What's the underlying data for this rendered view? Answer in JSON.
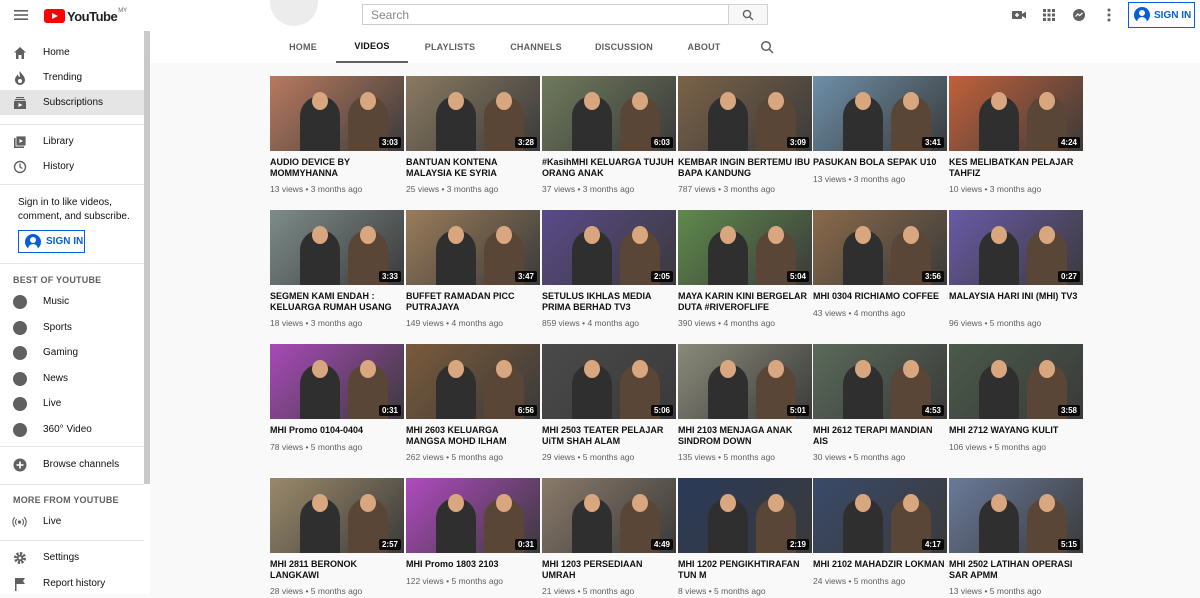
{
  "masthead": {
    "logo_text": "YouTube",
    "country": "MY",
    "search_placeholder": "Search",
    "sign_in": "SIGN IN",
    "icons": [
      "menu-icon",
      "video-camera-icon",
      "apps-icon",
      "chat-icon",
      "more-vert-icon"
    ]
  },
  "sidebar": {
    "main": [
      {
        "label": "Home",
        "icon": "home-icon"
      },
      {
        "label": "Trending",
        "icon": "fire-icon"
      },
      {
        "label": "Subscriptions",
        "icon": "subscriptions-icon",
        "active": true
      }
    ],
    "lib": [
      {
        "label": "Library",
        "icon": "library-icon"
      },
      {
        "label": "History",
        "icon": "history-icon"
      }
    ],
    "signin_prompt": "Sign in to like videos, comment, and subscribe.",
    "sign_in": "SIGN IN",
    "best_heading": "BEST OF YOUTUBE",
    "best": [
      {
        "label": "Music"
      },
      {
        "label": "Sports"
      },
      {
        "label": "Gaming"
      },
      {
        "label": "News"
      },
      {
        "label": "Live"
      },
      {
        "label": "360° Video"
      }
    ],
    "browse": "Browse channels",
    "more_heading": "MORE FROM YOUTUBE",
    "more_live": "Live",
    "settings": "Settings",
    "report_history": "Report history"
  },
  "tabs": [
    "HOME",
    "VIDEOS",
    "PLAYLISTS",
    "CHANNELS",
    "DISCUSSION",
    "ABOUT"
  ],
  "active_tab": "VIDEOS",
  "videos": [
    {
      "title": "AUDIO DEVICE BY MOMMYHANNA",
      "duration": "3:03",
      "views": "13 views",
      "age": "3 months ago",
      "c": "#b97a5f"
    },
    {
      "title": "BANTUAN KONTENA MALAYSIA KE SYRIA",
      "duration": "3:28",
      "views": "25 views",
      "age": "3 months ago",
      "c": "#8a7a62"
    },
    {
      "title": "#KasihMHI KELUARGA TUJUH ORANG ANAK",
      "duration": "6:03",
      "views": "37 views",
      "age": "3 months ago",
      "c": "#6f7a5c"
    },
    {
      "title": "KEMBAR INGIN BERTEMU IBU BAPA KANDUNG",
      "duration": "3:09",
      "views": "787 views",
      "age": "3 months ago",
      "c": "#7a6248"
    },
    {
      "title": "PASUKAN BOLA SEPAK U10",
      "duration": "3:41",
      "views": "13 views",
      "age": "3 months ago",
      "c": "#6e8fa8"
    },
    {
      "title": "KES MELIBATKAN PELAJAR TAHFIZ",
      "duration": "4:24",
      "views": "10 views",
      "age": "3 months ago",
      "c": "#c2603a"
    },
    {
      "title": "SEGMEN KAMI ENDAH : KELUARGA RUMAH USANG",
      "duration": "3:33",
      "views": "18 views",
      "age": "3 months ago",
      "c": "#7d8c8a"
    },
    {
      "title": "BUFFET RAMADAN PICC PUTRAJAYA",
      "duration": "3:47",
      "views": "149 views",
      "age": "4 months ago",
      "c": "#9a7c5a"
    },
    {
      "title": "SETULUS IKHLAS MEDIA PRIMA BERHAD TV3",
      "duration": "2:05",
      "views": "859 views",
      "age": "4 months ago",
      "c": "#5a4a8a"
    },
    {
      "title": "MAYA KARIN KINI BERGELAR DUTA #RIVEROFLIFE",
      "duration": "5:04",
      "views": "390 views",
      "age": "4 months ago",
      "c": "#5f8a4c"
    },
    {
      "title": "MHI 0304 RICHIAMO COFFEE",
      "duration": "3:56",
      "views": "43 views",
      "age": "4 months ago",
      "c": "#8a6a4a"
    },
    {
      "title": "MALAYSIA HARI INI (MHI) TV3",
      "duration": "0:27",
      "views": "96 views",
      "age": "5 months ago",
      "c": "#6a5aa8"
    },
    {
      "title": "MHI Promo 0104-0404",
      "duration": "0:31",
      "views": "78 views",
      "age": "5 months ago",
      "c": "#a84ab8"
    },
    {
      "title": "MHI 2603 KELUARGA MANGSA MOHD ILHAM",
      "duration": "6:56",
      "views": "262 views",
      "age": "5 months ago",
      "c": "#7a5a3a"
    },
    {
      "title": "MHI 2503 TEATER PELAJAR UiTM SHAH ALAM",
      "duration": "5:06",
      "views": "29 views",
      "age": "5 months ago",
      "c": "#4a4a4a"
    },
    {
      "title": "MHI 2103 MENJAGA ANAK SINDROM DOWN",
      "duration": "5:01",
      "views": "135 views",
      "age": "5 months ago",
      "c": "#8a8a7a"
    },
    {
      "title": "MHI 2612 TERAPI MANDIAN AIS",
      "duration": "4:53",
      "views": "30 views",
      "age": "5 months ago",
      "c": "#5a6a5a"
    },
    {
      "title": "MHI 2712 WAYANG KULIT",
      "duration": "3:58",
      "views": "106 views",
      "age": "5 months ago",
      "c": "#4a5a4a"
    },
    {
      "title": "MHI 2811 BERONOK LANGKAWI",
      "duration": "2:57",
      "views": "28 views",
      "age": "5 months ago",
      "c": "#9a8a6a"
    },
    {
      "title": "MHI Promo 1803 2103",
      "duration": "0:31",
      "views": "122 views",
      "age": "5 months ago",
      "c": "#b04ac0"
    },
    {
      "title": "MHI 1203 PERSEDIAAN UMRAH",
      "duration": "4:49",
      "views": "21 views",
      "age": "5 months ago",
      "c": "#8a7a6a"
    },
    {
      "title": "MHI 1202 PENGIKHTIRAFAN TUN M",
      "duration": "2:19",
      "views": "8 views",
      "age": "5 months ago",
      "c": "#2a3a5a"
    },
    {
      "title": "MHI 2102 MAHADZIR LOKMAN",
      "duration": "4:17",
      "views": "24 views",
      "age": "5 months ago",
      "c": "#3a4a6a"
    },
    {
      "title": "MHI 2502 LATIHAN OPERASI SAR APMM",
      "duration": "5:15",
      "views": "13 views",
      "age": "5 months ago",
      "c": "#6a7a9a"
    }
  ]
}
